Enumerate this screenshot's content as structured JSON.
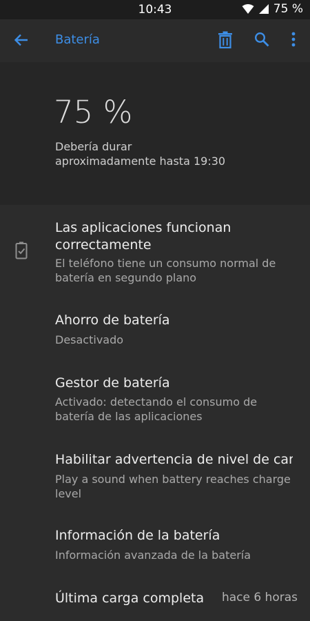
{
  "status_bar": {
    "time": "10:43",
    "battery_text": "75 %",
    "icons": [
      "wifi-icon",
      "signal-icon"
    ]
  },
  "app_bar": {
    "title": "Batería",
    "icons": [
      "back-arrow-icon",
      "delete-icon",
      "search-icon",
      "more-vert-icon"
    ]
  },
  "header": {
    "percent": "75 %",
    "estimate": "Debería durar\naproximadamente hasta 19:30"
  },
  "items": [
    {
      "title": "Las aplicaciones funcionan correctamente",
      "subtitle": "El teléfono tiene un consumo normal de batería en segundo plano",
      "icon": "battery-check-icon"
    },
    {
      "title": "Ahorro de batería",
      "subtitle": "Desactivado"
    },
    {
      "title": "Gestor de batería",
      "subtitle": "Activado: detectando el consumo de batería de las aplicaciones"
    },
    {
      "title": "Habilitar advertencia de nivel de car‥",
      "subtitle": "Play a sound when battery reaches charge level"
    },
    {
      "title": "Información de la batería",
      "subtitle": "Información avanzada de la batería"
    },
    {
      "title": "Última carga completa",
      "value": "hace 6 horas"
    }
  ],
  "colors": {
    "accent": "#3d8ee6",
    "background": "#2c2c2c",
    "header_background": "#262626",
    "status_bar": "#1d1d1d"
  }
}
